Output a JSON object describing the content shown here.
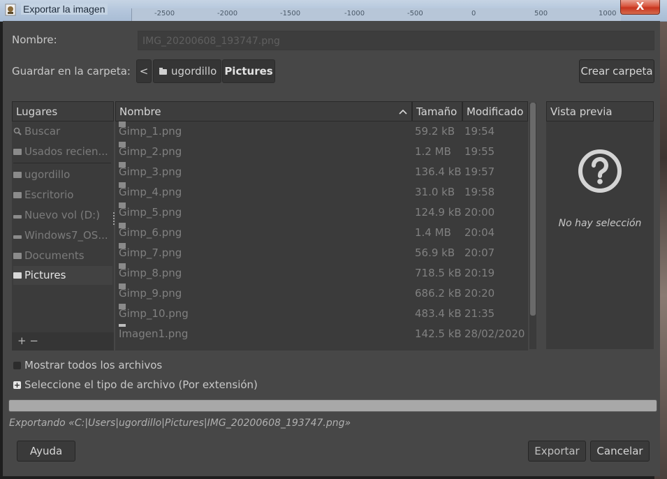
{
  "window": {
    "title": "Exportar la imagen",
    "close_label": "X",
    "ruler_ticks": [
      "-2500",
      "-2000",
      "-1500",
      "-1000",
      "-500",
      "0",
      "500",
      "1000"
    ]
  },
  "form": {
    "name_label": "Nombre:",
    "name_value": "IMG_20200608_193747.png",
    "folder_label": "Guardar en la carpeta:",
    "breadcrumb": {
      "back_label": "<",
      "items": [
        "ugordillo",
        "Pictures"
      ]
    },
    "create_folder_label": "Crear carpeta"
  },
  "places": {
    "header": "Lugares",
    "items": [
      {
        "label": "Buscar",
        "icon": "search-icon"
      },
      {
        "label": "Usados recien...",
        "icon": "recent-icon"
      },
      {
        "label": "ugordillo",
        "icon": "folder-icon"
      },
      {
        "label": "Escritorio",
        "icon": "folder-icon"
      },
      {
        "label": "Nuevo vol (D:)",
        "icon": "drive-icon"
      },
      {
        "label": "Windows7_OS...",
        "icon": "drive-icon"
      },
      {
        "label": "Documents",
        "icon": "folder-icon"
      },
      {
        "label": "Pictures",
        "icon": "folder-icon"
      }
    ],
    "footer": "+ −"
  },
  "files": {
    "columns": {
      "name": "Nombre",
      "sort_indicator": "^",
      "size": "Tamaño",
      "modified": "Modificado"
    },
    "rows": [
      {
        "name": "Gimp_1.png",
        "size": "59.2 kB",
        "modified": "19:54"
      },
      {
        "name": "Gimp_2.png",
        "size": "1.2 MB",
        "modified": "19:55"
      },
      {
        "name": "Gimp_3.png",
        "size": "136.4 kB",
        "modified": "19:57"
      },
      {
        "name": "Gimp_4.png",
        "size": "31.0 kB",
        "modified": "19:58"
      },
      {
        "name": "Gimp_5.png",
        "size": "124.9 kB",
        "modified": "20:00"
      },
      {
        "name": "Gimp_6.png",
        "size": "1.4 MB",
        "modified": "20:04"
      },
      {
        "name": "Gimp_7.png",
        "size": "56.9 kB",
        "modified": "20:07"
      },
      {
        "name": "Gimp_8.png",
        "size": "718.5 kB",
        "modified": "20:19"
      },
      {
        "name": "Gimp_9.png",
        "size": "686.2 kB",
        "modified": "20:20"
      },
      {
        "name": "Gimp_10.png",
        "size": "483.4 kB",
        "modified": "21:35"
      },
      {
        "name": "Imagen1.png",
        "size": "142.5 kB",
        "modified": "28/02/2020"
      }
    ]
  },
  "preview": {
    "header": "Vista previa",
    "empty_text": "No hay selección"
  },
  "options": {
    "show_all_label": "Mostrar todos los archivos",
    "file_type_label": "Seleccione el tipo de archivo (Por extensión)"
  },
  "status_text": "Exportando «C:|Users|ugordillo|Pictures|IMG_20200608_193747.png»",
  "footer": {
    "help_label": "Ayuda",
    "export_label": "Exportar",
    "cancel_label": "Cancelar"
  }
}
